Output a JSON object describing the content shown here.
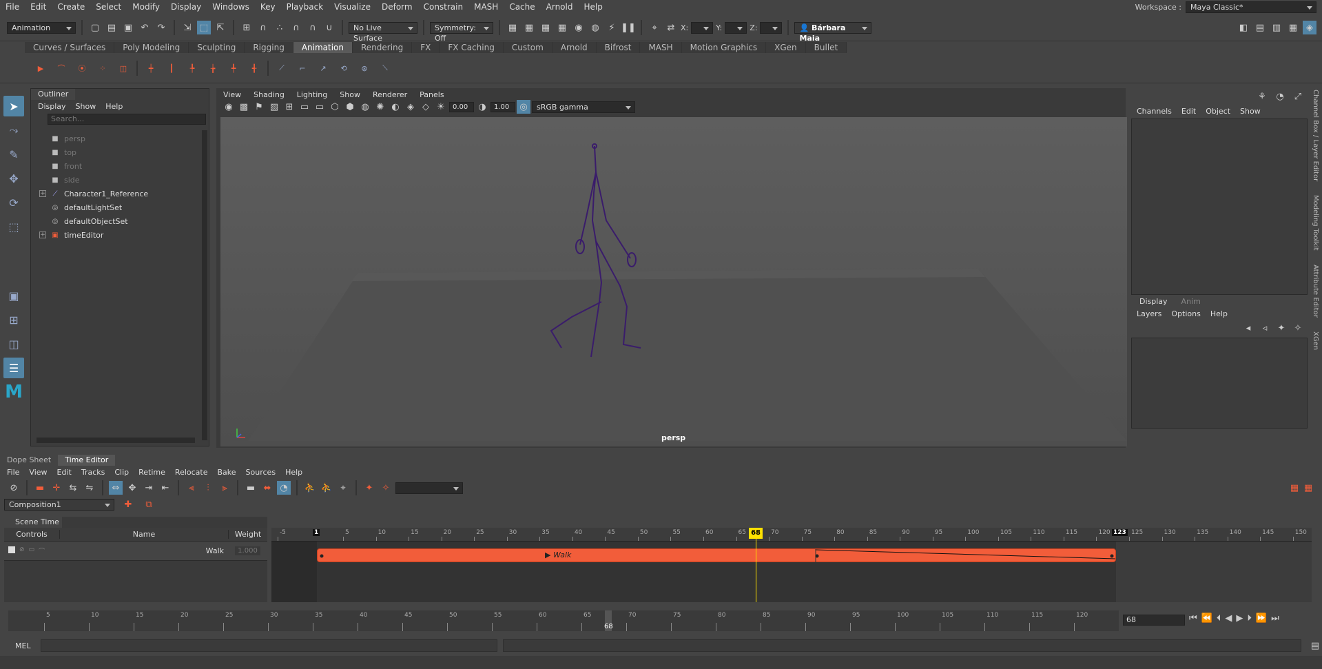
{
  "menubar": {
    "items": [
      "File",
      "Edit",
      "Create",
      "Select",
      "Modify",
      "Display",
      "Windows",
      "Key",
      "Playback",
      "Visualize",
      "Deform",
      "Constrain",
      "MASH",
      "Cache",
      "Arnold",
      "Help"
    ],
    "workspace_label": "Workspace :",
    "workspace_value": "Maya Classic*"
  },
  "statusline": {
    "mode": "Animation",
    "live_surface": "No Live Surface",
    "symmetry": "Symmetry: Off",
    "x_label": "X:",
    "y_label": "Y:",
    "z_label": "Z:",
    "user": "Bárbara Maia"
  },
  "shelf": {
    "tabs": [
      "Curves / Surfaces",
      "Poly Modeling",
      "Sculpting",
      "Rigging",
      "Animation",
      "Rendering",
      "FX",
      "FX Caching",
      "Custom",
      "Arnold",
      "Bifrost",
      "MASH",
      "Motion Graphics",
      "XGen",
      "Bullet"
    ],
    "active_tab": "Animation"
  },
  "outliner": {
    "tab": "Outliner",
    "menu": [
      "Display",
      "Show",
      "Help"
    ],
    "search_placeholder": "Search...",
    "nodes": [
      {
        "label": "persp",
        "icon": "camera-icon",
        "dim": true,
        "expand": false
      },
      {
        "label": "top",
        "icon": "camera-icon",
        "dim": true,
        "expand": false
      },
      {
        "label": "front",
        "icon": "camera-icon",
        "dim": true,
        "expand": false
      },
      {
        "label": "side",
        "icon": "camera-icon",
        "dim": true,
        "expand": false
      },
      {
        "label": "Character1_Reference",
        "icon": "joint-icon",
        "dim": false,
        "expand": true
      },
      {
        "label": "defaultLightSet",
        "icon": "set-icon",
        "dim": false,
        "expand": false
      },
      {
        "label": "defaultObjectSet",
        "icon": "set-icon",
        "dim": false,
        "expand": false
      },
      {
        "label": "timeEditor",
        "icon": "time-editor-icon",
        "dim": false,
        "expand": true
      }
    ]
  },
  "viewport": {
    "menu": [
      "View",
      "Shading",
      "Lighting",
      "Show",
      "Renderer",
      "Panels"
    ],
    "exposure": "0.00",
    "gamma": "1.00",
    "color_space": "sRGB gamma",
    "camera": "persp"
  },
  "channelbox": {
    "menu": [
      "Channels",
      "Edit",
      "Object",
      "Show"
    ],
    "layer_tabs": [
      "Display",
      "Anim"
    ],
    "layer_menu": [
      "Layers",
      "Options",
      "Help"
    ],
    "side_tabs": [
      "Channel Box / Layer Editor",
      "Modeling Toolkit",
      "Attribute Editor",
      "XGen"
    ]
  },
  "time_editor": {
    "panel_tabs": [
      "Dope Sheet",
      "Time Editor"
    ],
    "active_panel_tab": "Time Editor",
    "menu": [
      "File",
      "View",
      "Edit",
      "Tracks",
      "Clip",
      "Retime",
      "Relocate",
      "Bake",
      "Sources",
      "Help"
    ],
    "composition": "Composition1",
    "scene_time": "Scene Time",
    "columns": [
      "Controls",
      "Name",
      "Weight"
    ],
    "track_name": "Walk",
    "track_weight": "1.000",
    "clip_label": "Walk",
    "clip_start": 1,
    "clip_end": 123,
    "playhead_frame": "68",
    "start_frame_label": "1",
    "end_frame_label": "123",
    "ruler_labels": [
      "-5",
      "5",
      "10",
      "15",
      "20",
      "25",
      "30",
      "35",
      "40",
      "45",
      "50",
      "55",
      "60",
      "65",
      "70",
      "75",
      "80",
      "85",
      "90",
      "95",
      "100",
      "105",
      "110",
      "115",
      "120",
      "125",
      "130",
      "135",
      "140",
      "145",
      "150"
    ]
  },
  "timeslider": {
    "labels": [
      "5",
      "10",
      "15",
      "20",
      "25",
      "30",
      "35",
      "40",
      "45",
      "50",
      "55",
      "60",
      "65",
      "70",
      "75",
      "80",
      "85",
      "90",
      "95",
      "100",
      "105",
      "110",
      "115",
      "120"
    ],
    "current_frame": "68",
    "current_frame_field": "68"
  },
  "cmdline": {
    "label": "MEL"
  }
}
